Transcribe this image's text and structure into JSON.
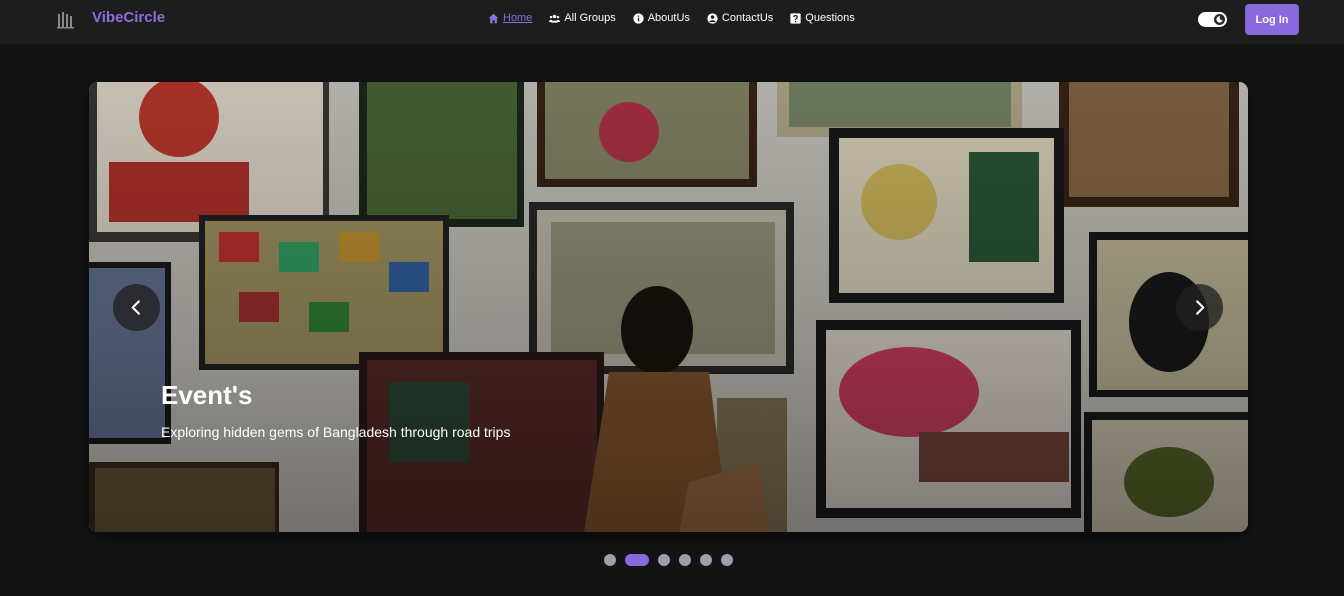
{
  "brand": {
    "name": "VibeCircle",
    "logo_icon": "building-columns-icon"
  },
  "nav": {
    "items": [
      {
        "label": "Home",
        "icon": "home-icon",
        "active": true
      },
      {
        "label": "All Groups",
        "icon": "users-icon",
        "active": false
      },
      {
        "label": "AboutUs",
        "icon": "info-icon",
        "active": false
      },
      {
        "label": "ContactUs",
        "icon": "user-circle-icon",
        "active": false
      },
      {
        "label": "Questions",
        "icon": "question-icon",
        "active": false
      }
    ]
  },
  "theme_toggle": {
    "icon": "moon-icon"
  },
  "login_button": {
    "label": "Log In"
  },
  "slider": {
    "title": "Event's",
    "caption": "Exploring hidden gems of Bangladesh through road trips",
    "prev_icon": "chevron-left-icon",
    "next_icon": "chevron-right-icon",
    "slide_count": 6,
    "active_slide": 2
  },
  "colors": {
    "accent": "#8a68de",
    "navbar_bg": "#1d1d1d",
    "page_bg": "#141414",
    "dot_inactive": "#9b9fae"
  }
}
